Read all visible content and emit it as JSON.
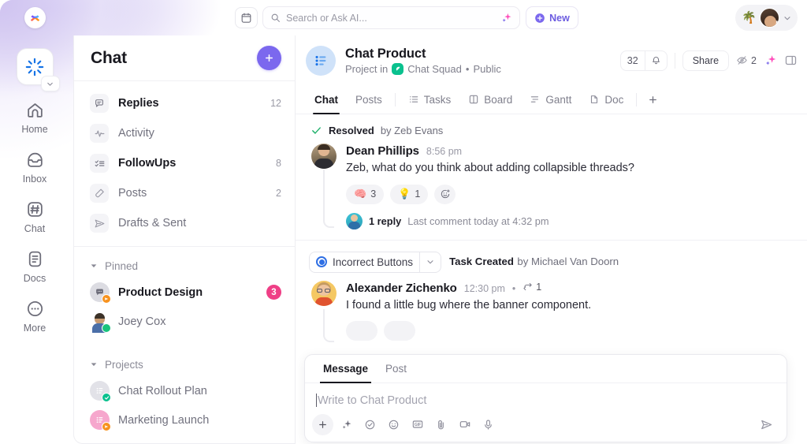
{
  "topbar": {
    "logo_icon": "clickup-logo-icon",
    "calendar_icon": "calendar-icon",
    "search": {
      "placeholder": "Search or Ask AI...",
      "value": "",
      "ai_icon": "ai-sparkle-icon"
    },
    "new_button": {
      "label": "New",
      "icon": "plus-circle-icon"
    },
    "status_emoji": "🌴",
    "avatar_chevron_icon": "chevron-down-icon"
  },
  "rail": {
    "workspace_icon": "workspace-loading-icon",
    "workspace_caret_icon": "chevron-down-icon",
    "items": [
      {
        "label": "Home",
        "icon": "home-icon"
      },
      {
        "label": "Inbox",
        "icon": "inbox-icon"
      },
      {
        "label": "Chat",
        "icon": "hash-square-icon"
      },
      {
        "label": "Docs",
        "icon": "doc-icon"
      },
      {
        "label": "More",
        "icon": "ellipsis-circle-icon"
      }
    ]
  },
  "panel": {
    "title": "Chat",
    "add_button_icon": "plus-icon",
    "nav": [
      {
        "label": "Replies",
        "count": "12",
        "icon": "reply-bubble-icon",
        "bold": true
      },
      {
        "label": "Activity",
        "count": "",
        "icon": "activity-pulse-icon",
        "bold": false
      },
      {
        "label": "FollowUps",
        "count": "8",
        "icon": "checklist-icon",
        "bold": true
      },
      {
        "label": "Posts",
        "count": "2",
        "icon": "megaphone-icon",
        "bold": false
      },
      {
        "label": "Drafts & Sent",
        "count": "",
        "icon": "send-icon",
        "bold": false
      }
    ],
    "sections": [
      {
        "label": "Pinned",
        "caret_icon": "caret-down-icon",
        "items": [
          {
            "label": "Product Design",
            "badge": "3",
            "bold": true,
            "icon": "chat-square-icon",
            "mini": "orange-send-badge"
          },
          {
            "label": "Joey Cox",
            "badge": "",
            "bold": false,
            "icon": "user-avatar",
            "mini": "online-dot"
          }
        ]
      },
      {
        "label": "Projects",
        "caret_icon": "caret-down-icon",
        "items": [
          {
            "label": "Chat Rollout Plan",
            "badge": "",
            "bold": false,
            "icon": "list-square-icon",
            "mini": "teal-check-badge"
          },
          {
            "label": "Marketing Launch",
            "badge": "",
            "bold": false,
            "icon": "list-square-pink-icon",
            "mini": "orange-send-badge"
          }
        ]
      }
    ]
  },
  "main": {
    "header": {
      "icon": "project-list-icon",
      "title": "Chat Product",
      "subtitle_prefix": "Project in",
      "space_name": "Chat Squad",
      "space_icon": "green-pen-icon",
      "separator": "•",
      "visibility": "Public",
      "member_count": "32",
      "bell_icon": "bell-icon",
      "share_label": "Share",
      "watchers_icon": "eye-off-icon",
      "watchers_count": "2",
      "ai_icon": "ai-sparkle-icon",
      "panel_icon": "sidebar-panel-icon"
    },
    "tabs": [
      {
        "label": "Chat",
        "icon": "",
        "active": true
      },
      {
        "label": "Posts",
        "icon": "",
        "active": false
      },
      {
        "label": "Tasks",
        "icon": "list-icon",
        "active": false
      },
      {
        "label": "Board",
        "icon": "board-icon",
        "active": false
      },
      {
        "label": "Gantt",
        "icon": "gantt-icon",
        "active": false
      },
      {
        "label": "Doc",
        "icon": "doc-small-icon",
        "active": false
      }
    ],
    "add_tab_icon": "plus-icon",
    "resolved": {
      "icon": "check-icon",
      "label": "Resolved",
      "by_text": "by Zeb Evans"
    },
    "message_1": {
      "author": "Dean Phillips",
      "time": "8:56 pm",
      "text": "Zeb, what do you think about adding collapsible threads?",
      "reactions": [
        {
          "emoji": "🧠",
          "count": "3"
        },
        {
          "emoji": "💡",
          "count": "1"
        }
      ],
      "add_reaction_icon": "add-reaction-icon",
      "reply_count": "1 reply",
      "reply_meta": "Last comment today at 4:32 pm"
    },
    "task_created": {
      "status_label": "Incorrect Buttons",
      "status_icon": "blue-radio-icon",
      "chevron_icon": "chevron-down-icon",
      "event_label": "Task Created",
      "event_by": "by Michael Van Doorn"
    },
    "message_2": {
      "author": "Alexander Zichenko",
      "time": "12:30 pm",
      "separator": "•",
      "thread_icon": "thread-icon",
      "thread_count": "1",
      "text": "I found a little bug where the banner component."
    },
    "composer": {
      "tabs": [
        {
          "label": "Message",
          "active": true
        },
        {
          "label": "Post",
          "active": false
        }
      ],
      "placeholder": "Write to Chat Product",
      "value": "",
      "tools": [
        {
          "icon": "plus-icon",
          "name": "add-attachment-button"
        },
        {
          "icon": "ai-sparkle-icon",
          "name": "ai-write-button"
        },
        {
          "icon": "check-circle-icon",
          "name": "create-task-button"
        },
        {
          "icon": "emoji-icon",
          "name": "emoji-button"
        },
        {
          "icon": "gif-icon",
          "name": "gif-button"
        },
        {
          "icon": "paperclip-icon",
          "name": "attach-file-button"
        },
        {
          "icon": "video-icon",
          "name": "record-video-button"
        },
        {
          "icon": "mic-icon",
          "name": "record-audio-button"
        }
      ],
      "send_icon": "send-icon"
    }
  },
  "colors": {
    "accent_purple": "#7b68ee",
    "badge_pink": "#ef3f86",
    "green": "#0ac18e",
    "blue": "#2f6fe4",
    "orange": "#f79421"
  }
}
